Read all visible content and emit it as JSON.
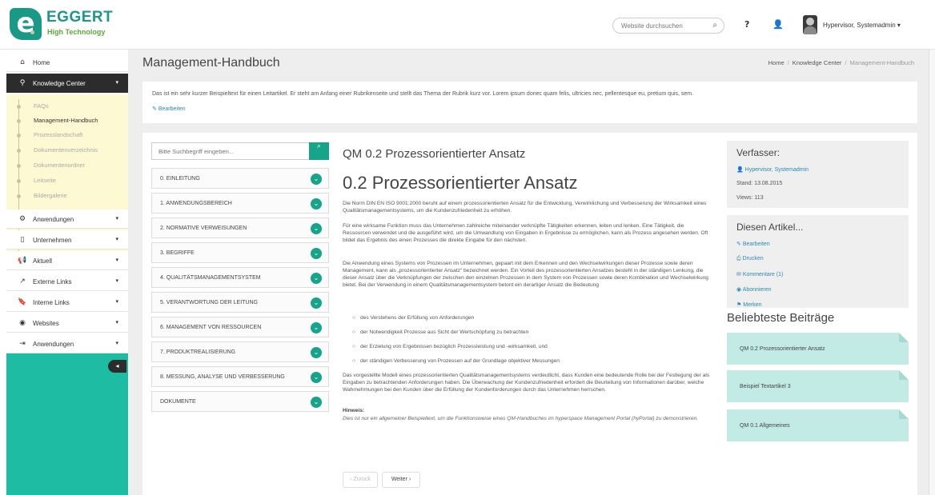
{
  "header": {
    "logo_letter": "e",
    "brand": "EGGERT",
    "brand_sub": "High Technology",
    "search_placeholder": "Website durchsuchen",
    "help": "?",
    "username": "Hypervisor, Systemadmin ▾"
  },
  "sidebar": {
    "items": [
      {
        "label": "Home"
      },
      {
        "label": "Knowledge Center"
      },
      {
        "label": "Anwendungen"
      },
      {
        "label": "Unternehmen"
      },
      {
        "label": "Aktuell"
      },
      {
        "label": "Externe Links"
      },
      {
        "label": "Interne Links"
      },
      {
        "label": "Websites"
      },
      {
        "label": "Anwendungen"
      }
    ],
    "sub_items": [
      {
        "label": "FAQs"
      },
      {
        "label": "Management-Handbuch"
      },
      {
        "label": "Prozesslandschaft"
      },
      {
        "label": "Dokumentenverzeichnis"
      },
      {
        "label": "Dokumentenordner"
      },
      {
        "label": "Leitseite"
      },
      {
        "label": "Bildergalerie"
      }
    ],
    "toggle": "◂"
  },
  "page": {
    "title": "Management-Handbuch",
    "breadcrumb": [
      "Home",
      "Knowledge Center",
      "Management-Handbuch"
    ],
    "intro_text": "Das ist ein sehr kurzer Beispieltext für einen Leitartikel. Er steht am Anfang einer Rubrikenseite und stellt das Thema der Rubrik kurz vor. Lorem ipsum donec quam felis, ultricies nec, pellentesque eu, pretium quis, sem.",
    "intro_edit": "Bearbeiten"
  },
  "toc": {
    "search_placeholder": "Bitte Suchbegriff eingeben...",
    "chapters": [
      {
        "label": "0. EINLEITUNG"
      },
      {
        "label": "1. ANWENDUNGSBEREICH"
      },
      {
        "label": "2. NORMATIVE VERWEISUNGEN"
      },
      {
        "label": "3. BEGRIFFE"
      },
      {
        "label": "4. QUALITÄTSMANAGEMENTSYSTEM"
      },
      {
        "label": "5. VERANTWORTUNG DER LEITUNG"
      },
      {
        "label": "6. MANAGEMENT VON RESSOURCEN"
      },
      {
        "label": "7. PRODUKTREALISIERUNG"
      },
      {
        "label": "8. MESSUNG, ANALYSE UND VERBESSERUNG"
      },
      {
        "label": "DOKUMENTE"
      }
    ]
  },
  "article": {
    "kicker": "QM 0.2 Prozessorientierter Ansatz",
    "heading": "0.2 Prozessorientierter Ansatz",
    "p1": "Die Norm DIN EN ISO 9001:2000 beruht auf einem prozessorientierten Ansatz für die Entwicklung, Verwirklichung und Verbesserung der Wirksamkeit eines Qualitätsmanagementsystems, um die Kundenzufriedenheit zu erhöhen.",
    "p2": "Für eine wirksame Funktion muss das Unternehmen zahlreiche miteinander verknüpfte Tätigkeiten erkennen, leiten und lenken. Eine Tätigkeit, die Ressourcen verwendet und die ausgeführt wird, um die Umwandlung von Eingaben in Ergebnisse zu ermöglichen, kann als Prozess angesehen werden. Oft bildet das Ergebnis des einen Prozesses die direkte Eingabe für den nächsten.",
    "p3": "Die Anwendung eines Systems von Prozessen im Unternehmen, gepaart mit dem Erkennen und den Wechselwirkungen dieser Prozesse sowie deren Management, kann als „prozessorientierter Ansatz“ bezeichnet werden. Ein Vorteil des prozessorientierten Ansatzes besteht in der ständigen Lenkung, die dieser Ansatz über die Verknüpfungen der zwischen den einzelnen Prozessen in dem System von Prozessen sowie deren Kombination und Wechselwirkung bietet. Bei der Verwendung in einem Qualitätsmanagementsystem betont ein derartiger Ansatz die Bedeutung",
    "bullets": [
      "des Verstehens der Erfüllung von Anforderungen",
      "der Notwendigkeit Prozesse aus Sicht der Wertschöpfung zu betrachten",
      "der Erzielung von Ergebnissen bezüglich Prozessleistung und -wirksamkeit, und",
      "der ständigen Verbesserung von Prozessen auf der Grundlage objektiver Messungen."
    ],
    "p4": "Das vorgestellte Modell eines prozessorientierten Qualitätsmanagementsystems verdeutlicht, dass Kunden eine bedeutende Rolle bei der Festlegung der als Eingaben zu betrachtenden Anforderungen haben. Die Überwachung der Kundenzufriedenheit erfordert die Beurteilung von Informationen darüber, welche Wahrnehmungen bei den Kunden über die Erfüllung der Kundenforderungen durch das Unternehmen herrschen.",
    "hint_label": "Hinweis:",
    "hint": "Dies ist nur ein allgemeiner Beispieltext, um die Funktionsweise eines QM-Handbuches im hyperspace Management Portal (hyPortal) zu demonstrieren.",
    "prev": "‹ Zurück",
    "next": "Weiter ›"
  },
  "author_box": {
    "title": "Verfasser:",
    "author": "Hypervisor, Systemadmin",
    "date": "Stand: 13.08.2015",
    "views": "Views: 113"
  },
  "actions_box": {
    "title": "Diesen Artikel...",
    "items": [
      {
        "label": "Bearbeiten"
      },
      {
        "label": "Drucken"
      },
      {
        "label": "Kommentare (1)"
      },
      {
        "label": "Abonnieren"
      },
      {
        "label": "Merken"
      }
    ]
  },
  "popular": {
    "title": "Beliebteste Beiträge",
    "items": [
      {
        "label": "QM 0.2 Prozessorientierter Ansatz"
      },
      {
        "label": "Beispiel Textartikel 3"
      },
      {
        "label": "QM 0.1 Allgemeines"
      }
    ]
  },
  "colors": {
    "accent": "#16a58b",
    "sidebar": "#1ebda3",
    "submenu": "#fdf9d3",
    "active": "#2c2c2c",
    "card": "#c3ebe5"
  }
}
